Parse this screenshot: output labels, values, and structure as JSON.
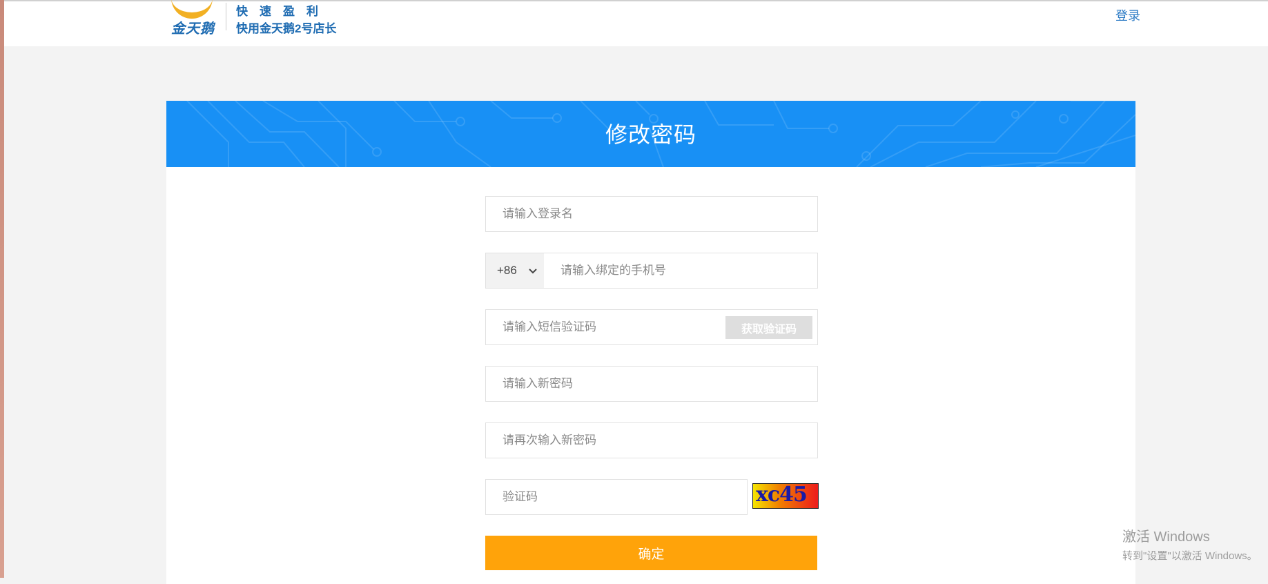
{
  "header": {
    "logo_name": "金天鹅",
    "slogan_line1": "快速盈利",
    "slogan_line2": "快用金天鹅2号店长",
    "login_label": "登录"
  },
  "panel": {
    "title": "修改密码"
  },
  "form": {
    "username_placeholder": "请输入登录名",
    "country_code": "+86",
    "phone_placeholder": "请输入绑定的手机号",
    "sms_placeholder": "请输入短信验证码",
    "sms_button_label": "获取验证码",
    "new_password_placeholder": "请输入新密码",
    "confirm_password_placeholder": "请再次输入新密码",
    "captcha_placeholder": "验证码",
    "captcha_text": "xc45",
    "submit_label": "确定"
  },
  "watermark": {
    "title": "激活 Windows",
    "subtitle": "转到\"设置\"以激活 Windows。"
  },
  "colors": {
    "banner": "#1890f5",
    "submit": "#ffa30a",
    "brand_blue": "#1f6cb2",
    "logo_gold": "#f2b023"
  }
}
